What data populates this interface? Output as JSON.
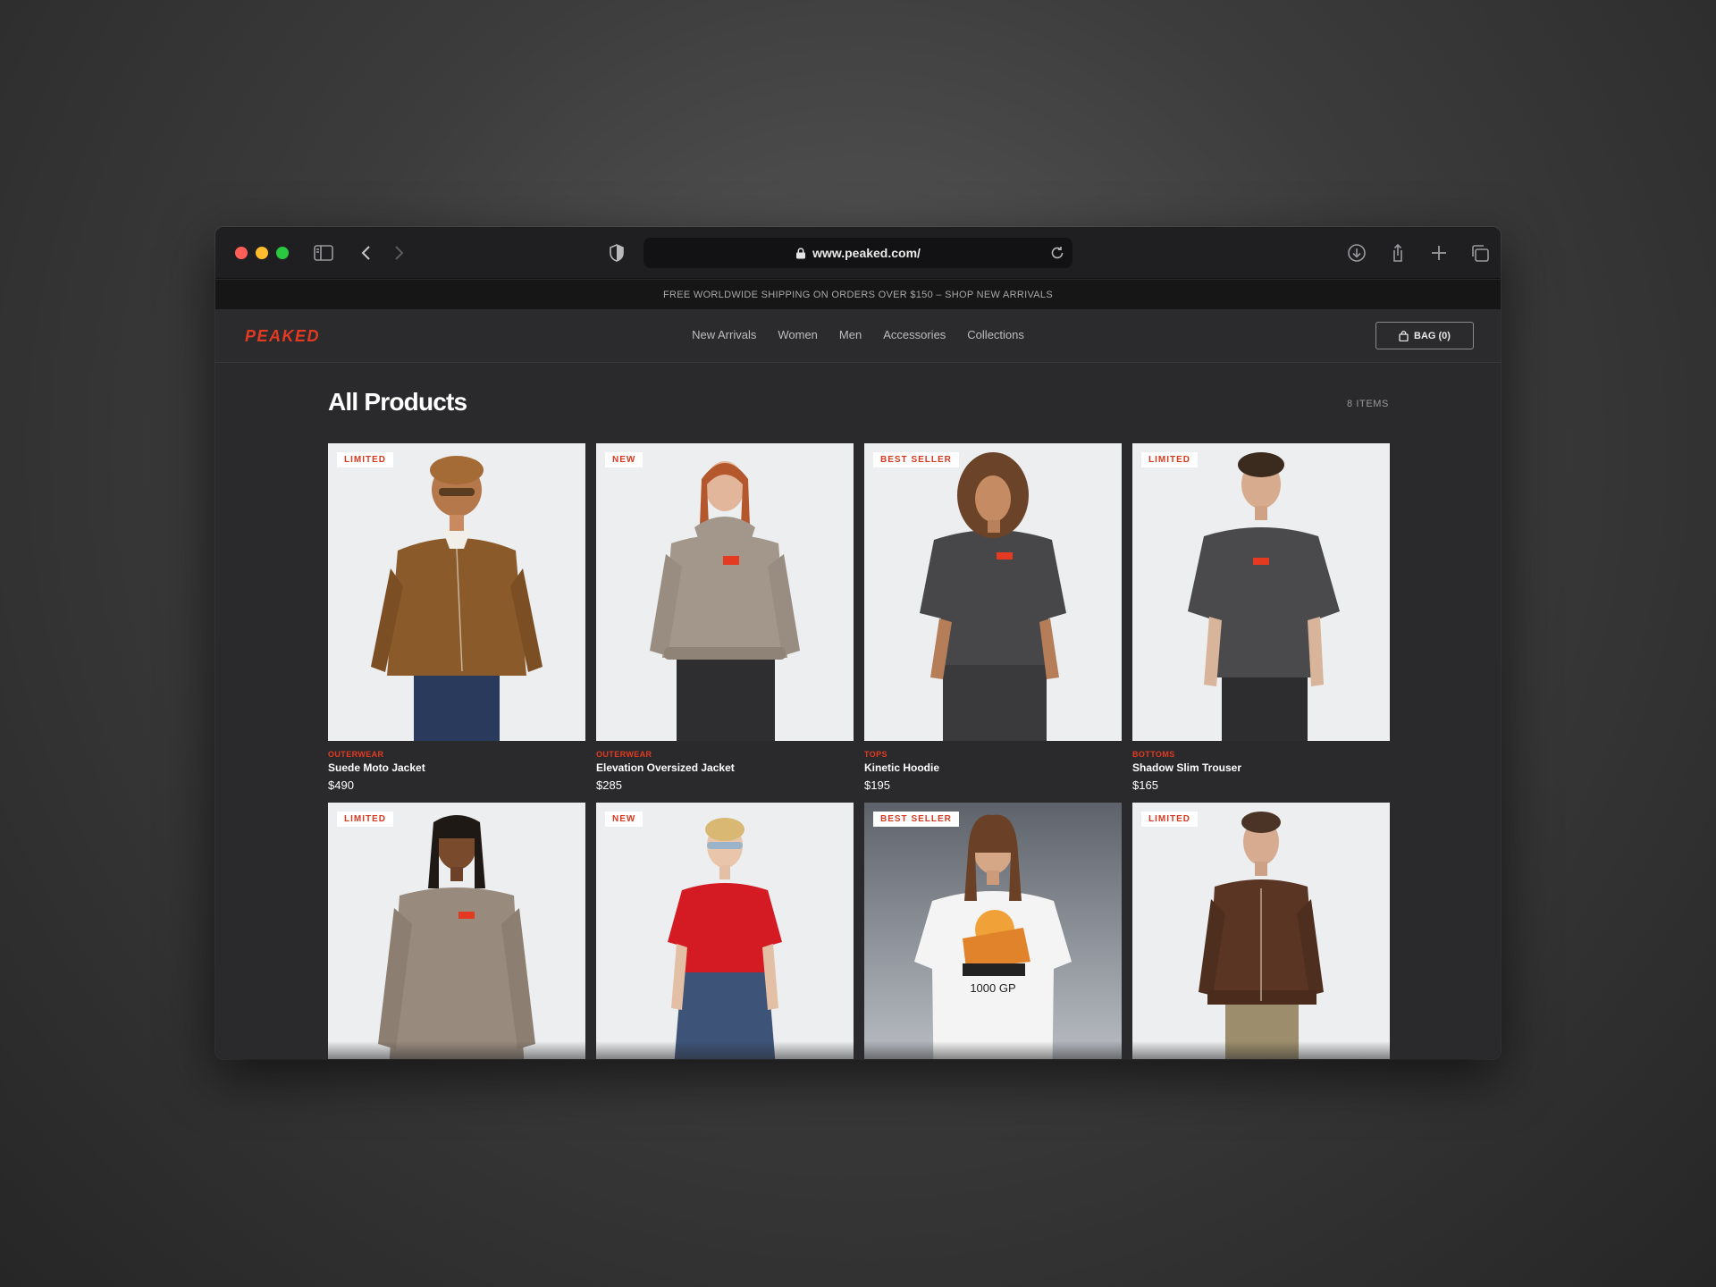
{
  "browser": {
    "url": "www.peaked.com/"
  },
  "announcement": "FREE WORLDWIDE SHIPPING ON ORDERS OVER $150 – SHOP NEW ARRIVALS",
  "header": {
    "logo": "PEAKED",
    "nav": [
      "New Arrivals",
      "Women",
      "Men",
      "Accessories",
      "Collections"
    ],
    "bag_label": "BAG (0)"
  },
  "main": {
    "title": "All Products",
    "count": "8 ITEMS",
    "products": [
      {
        "badge": "LIMITED",
        "category": "OUTERWEAR",
        "name": "Suede Moto Jacket",
        "price": "$490"
      },
      {
        "badge": "NEW",
        "category": "OUTERWEAR",
        "name": "Elevation Oversized Jacket",
        "price": "$285"
      },
      {
        "badge": "BEST SELLER",
        "category": "TOPS",
        "name": "Kinetic Hoodie",
        "price": "$195"
      },
      {
        "badge": "LIMITED",
        "category": "BOTTOMS",
        "name": "Shadow Slim Trouser",
        "price": "$165"
      },
      {
        "badge": "LIMITED"
      },
      {
        "badge": "NEW"
      },
      {
        "badge": "BEST SELLER"
      },
      {
        "badge": "LIMITED"
      }
    ]
  },
  "colors": {
    "accent": "#e43a22",
    "page_bg": "#2a2a2c"
  }
}
